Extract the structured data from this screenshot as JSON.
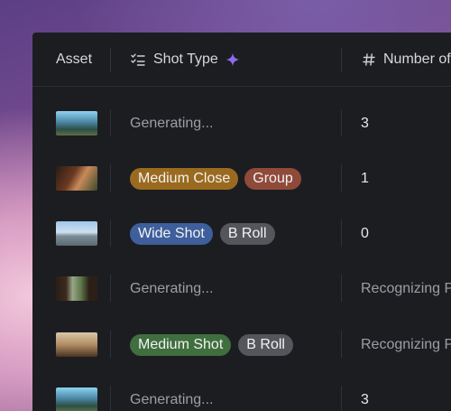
{
  "header": {
    "col_asset": "Asset",
    "col_shot_type": "Shot Type",
    "col_number": "Number of"
  },
  "icons": {
    "shot_type": "checklist-icon",
    "sparkle": "sparkle-icon",
    "number": "hash-icon"
  },
  "colors": {
    "panel_bg": "#1c1d21",
    "sparkle": "#8b6cf0",
    "tag_medium_close": "#9a6a1f",
    "tag_group": "#8f4a3a",
    "tag_wide_shot": "#3e5f9c",
    "tag_b_roll": "#55565c",
    "tag_medium_shot": "#3f6e3f"
  },
  "rows": [
    {
      "status": "Generating...",
      "tags": [],
      "number": "3",
      "number_status": ""
    },
    {
      "status": "",
      "tags": [
        "Medium Close",
        "Group"
      ],
      "number": "1",
      "number_status": ""
    },
    {
      "status": "",
      "tags": [
        "Wide Shot",
        "B Roll"
      ],
      "number": "0",
      "number_status": ""
    },
    {
      "status": "Generating...",
      "tags": [],
      "number": "",
      "number_status": "Recognizing P"
    },
    {
      "status": "",
      "tags": [
        "Medium Shot",
        "B Roll"
      ],
      "number": "",
      "number_status": "Recognizing P"
    },
    {
      "status": "Generating...",
      "tags": [],
      "number": "3",
      "number_status": ""
    }
  ]
}
